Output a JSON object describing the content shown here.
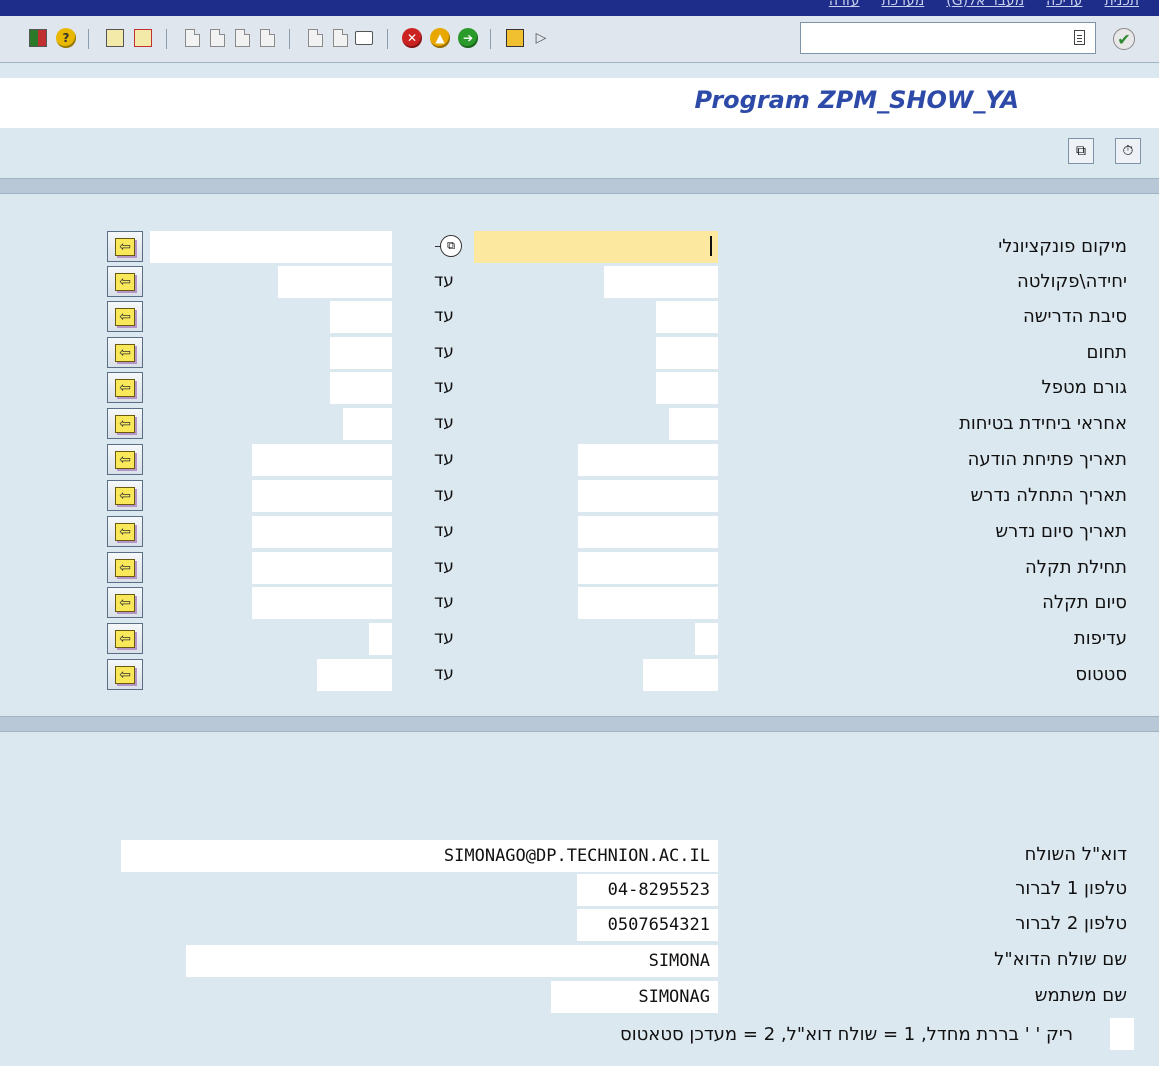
{
  "menu": [
    "תכנית",
    "עריכה",
    "מעבר אל(G)",
    "מערכת",
    "עזרה"
  ],
  "toolbar": {
    "command_field_value": "",
    "icons": [
      "layout-menu-icon",
      "help-icon",
      "select-all-icon",
      "deselect-icon",
      "cut-icon",
      "copy-icon",
      "paste-icon",
      "new-row-icon",
      "find-icon",
      "find-next-icon",
      "print-icon",
      "cancel-icon",
      "back-icon",
      "exit-icon",
      "save-icon",
      "play-icon",
      "enter-icon"
    ]
  },
  "title": "Program ZPM_SHOW_YA",
  "apptoolbar": {
    "icons": [
      "multiple-selection-icon",
      "execute-icon"
    ]
  },
  "criteria": {
    "to_label": "עד",
    "rows": [
      {
        "label": "מיקום פונקציונלי",
        "from": "",
        "to": ""
      },
      {
        "label": "יחידה\\פקולטה",
        "from": "",
        "to": ""
      },
      {
        "label": "סיבת הדרישה",
        "from": "",
        "to": ""
      },
      {
        "label": "תחום",
        "from": "",
        "to": ""
      },
      {
        "label": "גורם מטפל",
        "from": "",
        "to": ""
      },
      {
        "label": "אחראי ביחידת בטיחות",
        "from": "",
        "to": ""
      },
      {
        "label": "תאריך פתיחת הודעה",
        "from": "",
        "to": ""
      },
      {
        "label": "תאריך התחלה נדרש",
        "from": "",
        "to": ""
      },
      {
        "label": "תאריך סיום נדרש",
        "from": "",
        "to": ""
      },
      {
        "label": "תחילת תקלה",
        "from": "",
        "to": ""
      },
      {
        "label": "סיום תקלה",
        "from": "",
        "to": ""
      },
      {
        "label": "עדיפות",
        "from": "",
        "to": ""
      },
      {
        "label": "סטטוס",
        "from": "",
        "to": ""
      }
    ]
  },
  "params": {
    "sender_email_label": "דוא\"ל השולח",
    "sender_email": "SIMONAGO@DP.TECHNION.AC.IL",
    "phone1_label": "טלפון 1 לברור",
    "phone1": "04-8295523",
    "phone2_label": "טלפון 2 לברור",
    "phone2": "0507654321",
    "sender_name_label": "שם שולח הדוא\"ל",
    "sender_name": "SIMONA",
    "username_label": "שם משתמש",
    "username": "SIMONAG",
    "mode_note": "ריק ' ' בררת מחדל, 1 = שולח דוא\"ל, 2 = מעדכן סטאטוס",
    "mode_value": ""
  },
  "colors": {
    "title": "#2d4aa8",
    "active_field": "#fde8a0",
    "background": "#dce8f0"
  }
}
